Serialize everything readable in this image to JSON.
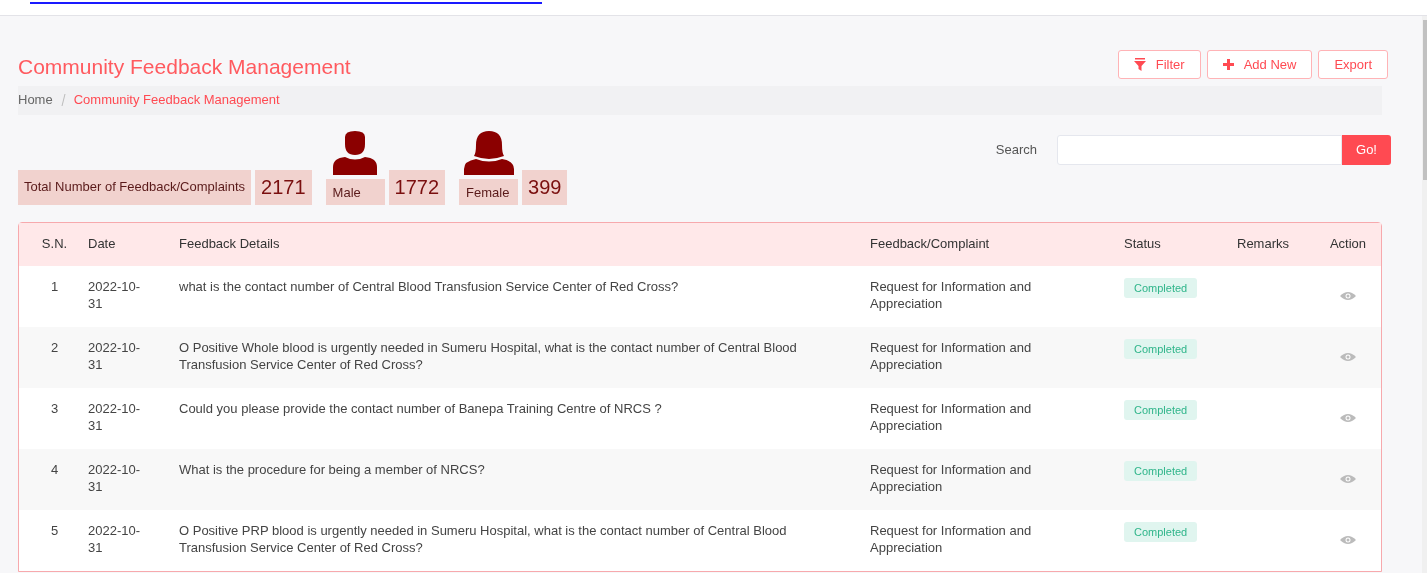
{
  "page": {
    "title": "Community Feedback Management"
  },
  "toolbar": [
    {
      "kind": "filter",
      "label": "Filter"
    },
    {
      "kind": "add",
      "label": "Add New"
    },
    {
      "kind": "plain",
      "label": "Export"
    }
  ],
  "breadcrumb": [
    {
      "label": "Home",
      "selected": false
    },
    {
      "label": "Community Feedback Management",
      "selected": true
    }
  ],
  "stats": [
    {
      "kind": "total",
      "label": "Total Number of Feedback/Complaints",
      "value": "2171"
    },
    {
      "kind": "male",
      "label": "Male",
      "value": "1772"
    },
    {
      "kind": "female",
      "label": "Female",
      "value": "399"
    }
  ],
  "search": {
    "label": "Search",
    "button": "Go!"
  },
  "table": {
    "columns": [
      "S.N.",
      "Date",
      "Feedback Details",
      "Feedback/Complaint",
      "Status",
      "Remarks",
      "Action"
    ],
    "rows": [
      {
        "sn": "1",
        "date": "2022-10-31",
        "details": "what is the contact number of Central Blood Transfusion Service Center of Red Cross?",
        "type": "Request for Information and Appreciation",
        "status": "Completed"
      },
      {
        "sn": "2",
        "date": "2022-10-31",
        "details": "O Positive Whole blood is urgently needed in Sumeru Hospital, what is the contact number of Central Blood Transfusion Service Center of Red Cross?",
        "type": "Request for Information and Appreciation",
        "status": "Completed"
      },
      {
        "sn": "3",
        "date": "2022-10-31",
        "details": "Could you please provide the contact number of Banepa Training Centre of NRCS ?",
        "type": "Request for Information and Appreciation",
        "status": "Completed"
      },
      {
        "sn": "4",
        "date": "2022-10-31",
        "details": "What is the procedure for being a member of NRCS?",
        "type": "Request for Information and Appreciation",
        "status": "Completed"
      },
      {
        "sn": "5",
        "date": "2022-10-31",
        "details": "O Positive PRP blood is urgently needed in Sumeru Hospital, what is the contact number of Central Blood Transfusion Service Center of Red Cross?",
        "type": "Request for Information and Appreciation",
        "status": "Completed"
      }
    ]
  }
}
